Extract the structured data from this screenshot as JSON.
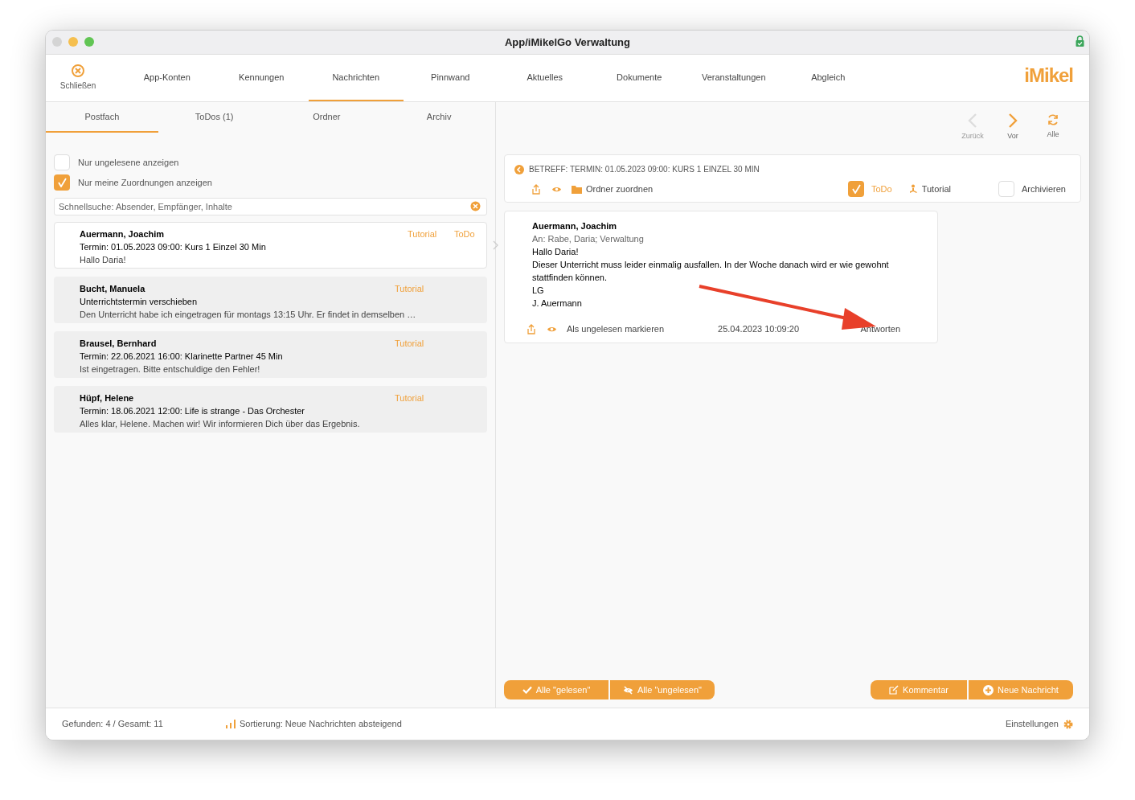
{
  "window": {
    "title": "App/iMikelGo Verwaltung"
  },
  "toolbar": {
    "close_label": "Schließen",
    "logo": "iMikel",
    "tabs": [
      {
        "label": "App-Konten",
        "selected": false
      },
      {
        "label": "Kennungen",
        "selected": false
      },
      {
        "label": "Nachrichten",
        "selected": true
      },
      {
        "label": "Pinnwand",
        "selected": false
      },
      {
        "label": "Aktuelles",
        "selected": false
      },
      {
        "label": "Dokumente",
        "selected": false
      },
      {
        "label": "Veranstaltungen",
        "selected": false
      },
      {
        "label": "Abgleich",
        "selected": false
      }
    ]
  },
  "mailbox_tabs": [
    {
      "label": "Postfach",
      "selected": true
    },
    {
      "label": "ToDos (1)",
      "selected": false
    },
    {
      "label": "Ordner",
      "selected": false
    },
    {
      "label": "Archiv",
      "selected": false
    }
  ],
  "filters": [
    {
      "label": "Nur ungelesene anzeigen",
      "checked": false
    },
    {
      "label": "Nur meine Zuordnungen anzeigen",
      "checked": true
    }
  ],
  "search": {
    "placeholder": "Schnellsuche: Absender, Empfänger, Inhalte"
  },
  "messages": [
    {
      "sender": "Auermann, Joachim",
      "subject": "Termin: 01.05.2023 09:00: Kurs 1 Einzel 30 Min",
      "preview": "Hallo Daria!",
      "tags": [
        "Tutorial",
        "ToDo"
      ],
      "selected": true
    },
    {
      "sender": "Bucht, Manuela",
      "subject": "Unterrichtstermin verschieben",
      "preview": "Den Unterricht habe ich eingetragen für montags 13:15 Uhr. Er findet in demselben …",
      "tags": [
        "Tutorial"
      ],
      "selected": false
    },
    {
      "sender": "Brausel, Bernhard",
      "subject": "Termin: 22.06.2021 16:00: Klarinette Partner 45 Min",
      "preview": "Ist eingetragen. Bitte entschuldige den Fehler!",
      "tags": [
        "Tutorial"
      ],
      "selected": false
    },
    {
      "sender": "Hüpf, Helene",
      "subject": "Termin: 18.06.2021 12:00: Life is strange - Das Orchester",
      "preview": "Alles klar, Helene. Machen wir! Wir informieren Dich über das Ergebnis.",
      "tags": [
        "Tutorial"
      ],
      "selected": false
    }
  ],
  "navigation": [
    {
      "kind": "back",
      "label": "Zurück",
      "disabled": true
    },
    {
      "kind": "forward",
      "label": "Vor",
      "disabled": false
    },
    {
      "kind": "refresh",
      "label": "Alle",
      "disabled": false
    }
  ],
  "subject_bar": {
    "subject": "BETREFF: TERMIN: 01.05.2023 09:00: KURS 1 EINZEL 30 MIN",
    "folder_label": "Ordner zuordnen",
    "todo": {
      "label": "ToDo",
      "checked": true
    },
    "tutorial_label": "Tutorial",
    "archive": {
      "label": "Archivieren",
      "checked": false
    }
  },
  "detail": {
    "sender": "Auermann, Joachim",
    "recipients": "An: Rabe, Daria; Verwaltung",
    "body": [
      "Hallo Daria!",
      "Dieser Unterricht muss leider einmalig ausfallen. In der Woche danach wird er wie gewohnt stattfinden können.",
      "LG",
      "J. Auermann"
    ],
    "mark_unread": "Als ungelesen markieren",
    "date": "25.04.2023 10:09:20",
    "reply": "Antworten"
  },
  "bottom_left_buttons": [
    {
      "kind": "check",
      "label": "Alle \"gelesen\""
    },
    {
      "kind": "eye-off",
      "label": "Alle \"ungelesen\""
    }
  ],
  "bottom_right_buttons": [
    {
      "kind": "edit",
      "label": "Kommentar"
    },
    {
      "kind": "plus",
      "label": "Neue Nachricht"
    }
  ],
  "status_bar": {
    "count": "Gefunden: 4 / Gesamt: 11",
    "sorting": "Sortierung: Neue Nachrichten absteigend",
    "settings": "Einstellungen"
  }
}
